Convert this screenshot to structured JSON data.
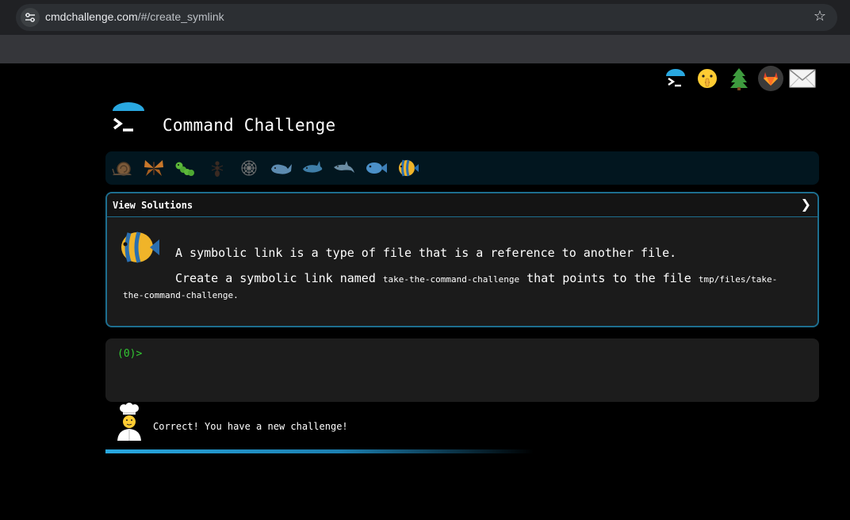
{
  "browser": {
    "url_host": "cmdchallenge.com",
    "url_path": "/#/create_symlink",
    "star_icon": "star-icon",
    "site_info_icon": "tune-icon"
  },
  "top_icons": [
    "terminal-logo-icon",
    "shushing-face-icon",
    "evergreen-tree-icon",
    "gitlab-icon",
    "envelope-icon"
  ],
  "header": {
    "title": "Command Challenge"
  },
  "levels": [
    "snail-icon",
    "butterfly-icon",
    "caterpillar-icon",
    "ant-icon",
    "web-icon",
    "whale-icon",
    "shark-icon",
    "dolphin-icon",
    "fish-icon",
    "tropical-fish-icon"
  ],
  "card": {
    "header_label": "View Solutions",
    "paragraph1": "A symbolic link is a type of file that is a reference to another file.",
    "p2_pre": "Create a symbolic link named ",
    "p2_code1": "take-the-command-challenge",
    "p2_mid": " that points to the file ",
    "p2_code2": "tmp/files/take-the-command-challenge",
    "p2_post": "."
  },
  "terminal": {
    "prompt": "(0)>"
  },
  "status": {
    "message": "Correct! You have a new challenge!",
    "avatar": "chef-icon"
  },
  "colors": {
    "accent": "#1d6e8f",
    "prompt": "#32c832",
    "progress": "#29a8e0"
  }
}
